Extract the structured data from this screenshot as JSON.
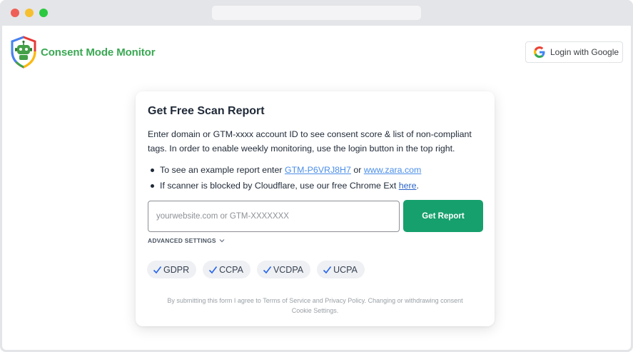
{
  "app": {
    "name": "Consent Mode Monitor",
    "login_label": "Login with Google"
  },
  "card": {
    "title": "Get Free Scan Report",
    "description": "Enter domain or GTM-xxxx account ID to see consent score & list of non-compliant tags. In order to enable weekly monitoring, use the login button in the top right.",
    "bullet1_prefix": "To see an example report enter ",
    "bullet1_link1": "GTM-P6VRJ8H7",
    "bullet1_or": " or ",
    "bullet1_link2": "www.zara.com",
    "bullet2_prefix": "If scanner is blocked by Cloudflare, use our free Chrome Ext ",
    "bullet2_link": "here",
    "bullet2_suffix": ".",
    "input_placeholder": "yourwebsite.com or GTM-XXXXXXX",
    "input_value": "",
    "submit_label": "Get Report",
    "advanced_label": "ADVANCED SETTINGS",
    "regulations": [
      "GDPR",
      "CCPA",
      "VCDPA",
      "UCPA"
    ],
    "footer_line1": "By submitting this form I agree to Terms of Service and Privacy Policy. Changing or withdrawing consent",
    "footer_line2": "Cookie Settings."
  },
  "colors": {
    "brand_green": "#3aa853",
    "button_green": "#16a06d",
    "link_blue": "#4a8ee8",
    "check_blue": "#2563eb"
  },
  "icons": {
    "logo": "shield-robot-icon",
    "google": "google-g-icon",
    "chevron": "chevron-down-icon",
    "check": "check-icon"
  }
}
